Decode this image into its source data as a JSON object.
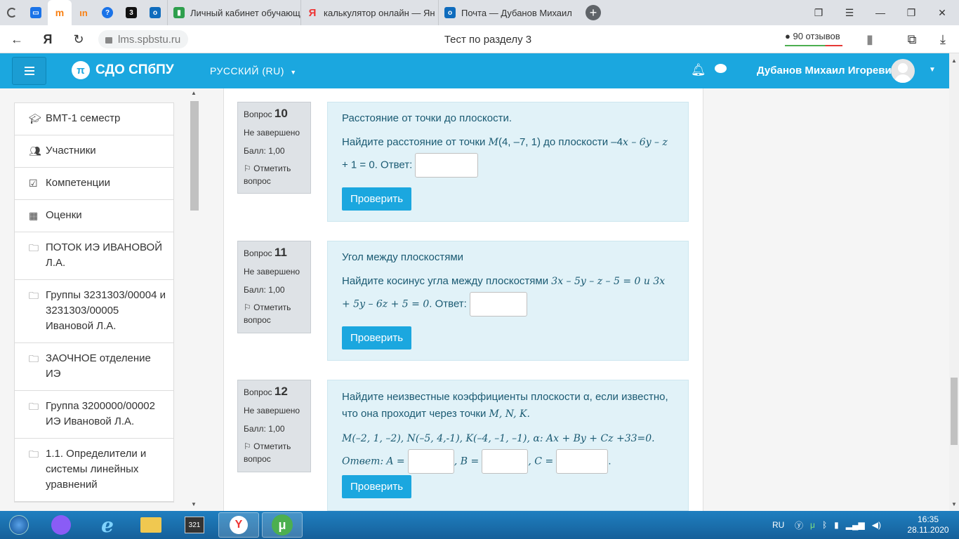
{
  "browser": {
    "tabs": [
      {
        "label": "Личный кабинет обучающ"
      },
      {
        "label": "калькулятор онлайн — Ян"
      },
      {
        "label": "Почта — Дубанов Михаил"
      }
    ],
    "url": "lms.spbstu.ru",
    "page_title": "Тест по разделу 3",
    "reviews": "90 отзывов"
  },
  "header": {
    "logo": "СДО СПбПУ",
    "language": "РУССКИЙ (RU)",
    "user_name": "Дубанов Михаил Игоревич"
  },
  "sidebar": {
    "items": [
      {
        "label": "ВМТ-1 семестр",
        "icon": "graduation-cap-icon"
      },
      {
        "label": "Участники",
        "icon": "users-icon"
      },
      {
        "label": "Компетенции",
        "icon": "checkbox-icon"
      },
      {
        "label": "Оценки",
        "icon": "table-icon"
      },
      {
        "label": "ПОТОК ИЭ ИВАНОВОЙ Л.А.",
        "icon": "folder-icon"
      },
      {
        "label": "Группы 3231303/00004 и 3231303/00005 Ивановой Л.А.",
        "icon": "folder-icon"
      },
      {
        "label": "ЗАОЧНОЕ отделение ИЭ",
        "icon": "folder-icon"
      },
      {
        "label": "Группа 3200000/00002 ИЭ Ивановой Л.А.",
        "icon": "folder-icon"
      },
      {
        "label": "1.1. Определители и системы линейных уравнений",
        "icon": "folder-icon"
      }
    ]
  },
  "questions": [
    {
      "word": "Вопрос",
      "number": "10",
      "status": "Не завершено",
      "score": "Балл: 1,00",
      "flag": "Отметить вопрос",
      "title": "Расстояние от точки до плоскости.",
      "text_pre": "Найдите расстояние от точки ",
      "math1": "M",
      "text_mid": "(4, –7, 1) до плоскости –4",
      "math2": "x – 6y – z",
      "text_tail": " + 1 = 0. Ответ:",
      "check": "Проверить"
    },
    {
      "word": "Вопрос",
      "number": "11",
      "status": "Не завершено",
      "score": "Балл: 1,00",
      "flag": "Отметить вопрос",
      "title": "Угол между плоскостями",
      "text_pre": "Найдите косинус угла между плоскостями ",
      "math1": "3x – 5y – z – 5 = 0 и 3x + 5y – 6z + 5 = 0",
      "text_tail": ". Ответ:",
      "check": "Проверить"
    },
    {
      "word": "Вопрос",
      "number": "12",
      "status": "Не завершено",
      "score": "Балл: 1,00",
      "flag": "Отметить вопрос",
      "title": "Найдите неизвестные коэффициенты плоскости α, если известно, что она проходит через точки ",
      "title_math": "M, N, K.",
      "points": "M(–2, 1, –2),  N(–5, 4,-1), K(–4, –1, –1), α: Ax + By + Cz +33=0. Ответ:",
      "label_a": "A =",
      "label_b": ", B =",
      "label_c": ", C =",
      "end": ".",
      "check": "Проверить"
    }
  ],
  "taskbar": {
    "lang": "RU",
    "time": "16:35",
    "date": "28.11.2020"
  }
}
